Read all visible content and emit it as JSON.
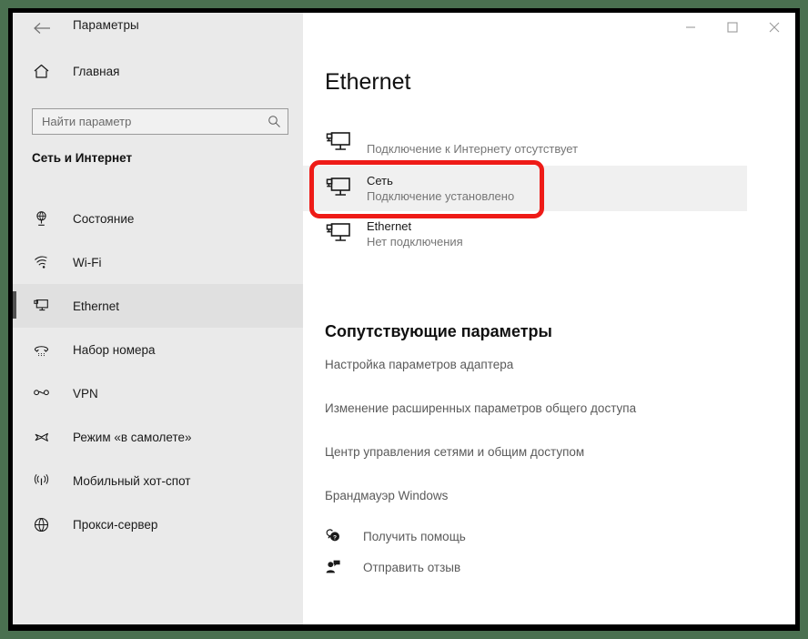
{
  "window": {
    "app_title": "Параметры",
    "back_icon": "back-arrow-icon",
    "minimize_label": "—",
    "maximize_label": "□",
    "close_label": "✕"
  },
  "sidebar": {
    "home": {
      "label": "Главная",
      "icon": "home-icon"
    },
    "search": {
      "placeholder": "Найти параметр",
      "value": "",
      "icon": "search-icon"
    },
    "section_title": "Сеть и Интернет",
    "items": [
      {
        "label": "Состояние",
        "icon": "status-globe-icon",
        "selected": false
      },
      {
        "label": "Wi-Fi",
        "icon": "wifi-icon",
        "selected": false
      },
      {
        "label": "Ethernet",
        "icon": "ethernet-icon",
        "selected": true
      },
      {
        "label": "Набор номера",
        "icon": "dialup-phone-icon",
        "selected": false
      },
      {
        "label": "VPN",
        "icon": "vpn-icon",
        "selected": false
      },
      {
        "label": "Режим «в самолете»",
        "icon": "airplane-icon",
        "selected": false
      },
      {
        "label": "Мобильный хот-спот",
        "icon": "hotspot-icon",
        "selected": false
      },
      {
        "label": "Прокси-сервер",
        "icon": "proxy-globe-icon",
        "selected": false
      }
    ]
  },
  "main": {
    "page_title": "Ethernet",
    "connections": [
      {
        "title": "",
        "subtitle": "Подключение к Интернету отсутствует",
        "icon": "network-pc-icon",
        "highlighted": false
      },
      {
        "title": "Сеть",
        "subtitle": "Подключение установлено",
        "icon": "network-pc-icon",
        "highlighted": true
      },
      {
        "title": "Ethernet",
        "subtitle": "Нет подключения",
        "icon": "network-pc-icon",
        "highlighted": false
      }
    ],
    "related_title": "Сопутствующие параметры",
    "related_links": [
      "Настройка параметров адаптера",
      "Изменение расширенных параметров общего доступа",
      "Центр управления сетями и общим доступом",
      "Брандмауэр Windows"
    ],
    "help_links": [
      {
        "label": "Получить помощь",
        "icon": "help-question-icon"
      },
      {
        "label": "Отправить отзыв",
        "icon": "feedback-person-icon"
      }
    ]
  },
  "annotation": {
    "type": "rectangle-highlight",
    "color": "#ee1b17",
    "targets": "Сеть"
  },
  "colors": {
    "backdrop": "#4a7050",
    "sidebar_bg": "#eaeaea",
    "content_bg": "#ffffff",
    "highlight_row": "#f0f0f0",
    "annotation_red": "#ee1b17",
    "text_primary": "#1a1a1a",
    "text_secondary": "#767676"
  }
}
